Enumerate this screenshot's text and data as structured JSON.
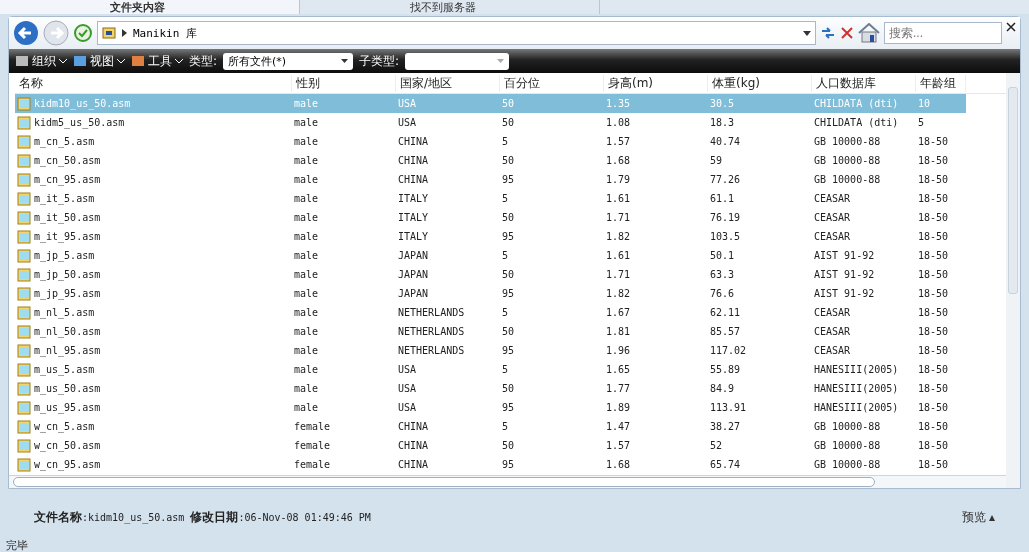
{
  "browser_tabs": [
    {
      "label": "文件夹内容",
      "selected": true
    },
    {
      "label": "找不到服务器",
      "selected": false
    }
  ],
  "address_bar": {
    "path": "Manikin 库"
  },
  "search": {
    "placeholder": "搜索..."
  },
  "toolbar": {
    "menus": [
      "组织",
      "视图",
      "工具"
    ],
    "type_label": "类型:",
    "type_value": "所有文件(*)",
    "subtype_label": "子类型:"
  },
  "table": {
    "columns": [
      "名称",
      "性别",
      "国家/地区",
      "百分位",
      "身高(m)",
      "体重(kg)",
      "人口数据库",
      "年龄组"
    ],
    "rows": [
      {
        "cells": [
          "kidm10_us_50.asm",
          "male",
          "USA",
          "50",
          "1.35",
          "30.5",
          "CHILDATA (dti)",
          "10"
        ],
        "selected": true
      },
      {
        "cells": [
          "kidm5_us_50.asm",
          "male",
          "USA",
          "50",
          "1.08",
          "18.3",
          "CHILDATA (dti)",
          "5"
        ],
        "selected": false
      },
      {
        "cells": [
          "m_cn_5.asm",
          "male",
          "CHINA",
          "5",
          "1.57",
          "40.74",
          "GB 10000-88",
          "18-50"
        ],
        "selected": false
      },
      {
        "cells": [
          "m_cn_50.asm",
          "male",
          "CHINA",
          "50",
          "1.68",
          "59",
          "GB 10000-88",
          "18-50"
        ],
        "selected": false
      },
      {
        "cells": [
          "m_cn_95.asm",
          "male",
          "CHINA",
          "95",
          "1.79",
          "77.26",
          "GB 10000-88",
          "18-50"
        ],
        "selected": false
      },
      {
        "cells": [
          "m_it_5.asm",
          "male",
          "ITALY",
          "5",
          "1.61",
          "61.1",
          "CEASAR",
          "18-50"
        ],
        "selected": false
      },
      {
        "cells": [
          "m_it_50.asm",
          "male",
          "ITALY",
          "50",
          "1.71",
          "76.19",
          "CEASAR",
          "18-50"
        ],
        "selected": false
      },
      {
        "cells": [
          "m_it_95.asm",
          "male",
          "ITALY",
          "95",
          "1.82",
          "103.5",
          "CEASAR",
          "18-50"
        ],
        "selected": false
      },
      {
        "cells": [
          "m_jp_5.asm",
          "male",
          "JAPAN",
          "5",
          "1.61",
          "50.1",
          "AIST 91-92",
          "18-50"
        ],
        "selected": false
      },
      {
        "cells": [
          "m_jp_50.asm",
          "male",
          "JAPAN",
          "50",
          "1.71",
          "63.3",
          "AIST 91-92",
          "18-50"
        ],
        "selected": false
      },
      {
        "cells": [
          "m_jp_95.asm",
          "male",
          "JAPAN",
          "95",
          "1.82",
          "76.6",
          "AIST 91-92",
          "18-50"
        ],
        "selected": false
      },
      {
        "cells": [
          "m_nl_5.asm",
          "male",
          "NETHERLANDS",
          "5",
          "1.67",
          "62.11",
          "CEASAR",
          "18-50"
        ],
        "selected": false
      },
      {
        "cells": [
          "m_nl_50.asm",
          "male",
          "NETHERLANDS",
          "50",
          "1.81",
          "85.57",
          "CEASAR",
          "18-50"
        ],
        "selected": false
      },
      {
        "cells": [
          "m_nl_95.asm",
          "male",
          "NETHERLANDS",
          "95",
          "1.96",
          "117.02",
          "CEASAR",
          "18-50"
        ],
        "selected": false
      },
      {
        "cells": [
          "m_us_5.asm",
          "male",
          "USA",
          "5",
          "1.65",
          "55.89",
          "HANESIII(2005)",
          "18-50"
        ],
        "selected": false
      },
      {
        "cells": [
          "m_us_50.asm",
          "male",
          "USA",
          "50",
          "1.77",
          "84.9",
          "HANESIII(2005)",
          "18-50"
        ],
        "selected": false
      },
      {
        "cells": [
          "m_us_95.asm",
          "male",
          "USA",
          "95",
          "1.89",
          "113.91",
          "HANESIII(2005)",
          "18-50"
        ],
        "selected": false
      },
      {
        "cells": [
          "w_cn_5.asm",
          "female",
          "CHINA",
          "5",
          "1.47",
          "38.27",
          "GB 10000-88",
          "18-50"
        ],
        "selected": false
      },
      {
        "cells": [
          "w_cn_50.asm",
          "female",
          "CHINA",
          "50",
          "1.57",
          "52",
          "GB 10000-88",
          "18-50"
        ],
        "selected": false
      },
      {
        "cells": [
          "w_cn_95.asm",
          "female",
          "CHINA",
          "95",
          "1.68",
          "65.74",
          "GB 10000-88",
          "18-50"
        ],
        "selected": false
      }
    ]
  },
  "details": {
    "name_label": "文件名称",
    "name_value": ":kidm10_us_50.asm",
    "date_label": "修改日期",
    "date_value": ":06-Nov-08 01:49:46 PM"
  },
  "preview_button": {
    "label": "预览",
    "caret": "▴"
  },
  "status_bar": "完毕"
}
